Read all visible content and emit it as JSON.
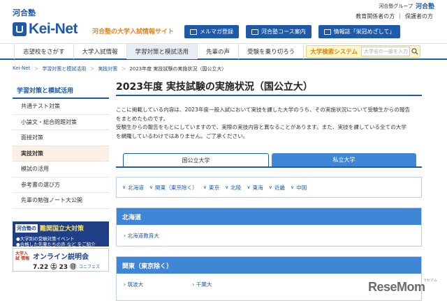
{
  "header": {
    "brand_small": "河合塾",
    "logo_text": "Kei-Net",
    "tagline": "河合塾の大学入試情報サイト",
    "group_label": "河合塾グループ",
    "group_logo": "河合塾",
    "util_links": [
      "教育関係者の方",
      "|",
      "保護者の方"
    ],
    "buttons": [
      {
        "label": "メルマガ登録",
        "icon": "mail-icon"
      },
      {
        "label": "河合塾コース案内",
        "icon": "building-icon"
      },
      {
        "label": "情報誌「栄冠めざして」",
        "icon": "book-icon"
      }
    ]
  },
  "gnav": {
    "items": [
      "志望校をさがす",
      "大学入試情報",
      "学習対策と模試活用",
      "先輩の声",
      "受験を乗り切ろう"
    ],
    "active_index": 2,
    "search_label": "大学検索システム",
    "search_placeholder": "大学名の一部を入力"
  },
  "breadcrumb": [
    "Kei-Net",
    "＞",
    "学習対策と模試活用",
    "＞",
    "実技対策",
    "＞",
    "2023年度 実技試験の実施状況（国公立大）"
  ],
  "sidebar": {
    "heading": "学習対策と模試活用",
    "items": [
      "共通テスト対策",
      "小論文・総合問題対策",
      "面接対策",
      "実技対策",
      "模試の活用",
      "参考書の選び方",
      "先輩の勉強ノート大公開"
    ],
    "active_index": 3,
    "banner1": {
      "tag": "河合塾の",
      "title": "難関国立大対策",
      "line1": "●大学別の受験対策イベント",
      "line2": "●合格した先輩たちの声 など をご紹介"
    },
    "banner2": {
      "tag": "大学入試 情報",
      "title": "オンライン説明会",
      "date": "7.22 ㊏ 23 ㊐",
      "logo": "ユニフェス"
    }
  },
  "main": {
    "title": "2023年度 実技試験の実施状況（国公立大）",
    "intro_lines": [
      "ここに掲載している内容は、2023年度一般入試において実技を課した大学のうち、その実施状況について受験生からの報告",
      "をまとめたものです。",
      "受験生からの報告をもとにしていますので、実際の実技内容と異なることがあります。また、実技を課している全ての大学",
      "を網羅しているわけではありません。ご了承ください。"
    ],
    "tabs": [
      "国公立大学",
      "私立大学"
    ],
    "active_tab": 0,
    "regions": [
      "北海道",
      "関東（東京除く）",
      "東京",
      "北陸",
      "東海",
      "近畿",
      "中国"
    ],
    "sections": [
      {
        "heading": "北海道",
        "links": [
          "北海道教育大"
        ]
      },
      {
        "heading": "関東（東京除く）",
        "links": [
          "筑波大",
          "千葉大"
        ]
      }
    ]
  },
  "watermark": {
    "text": "ReseMom",
    "sub": "リセマム"
  },
  "colors": {
    "primary": "#1e5aa8",
    "tab_blue": "#3f86d6",
    "accent_orange": "#e8831a",
    "active_side_bg": "#fdeee6"
  }
}
